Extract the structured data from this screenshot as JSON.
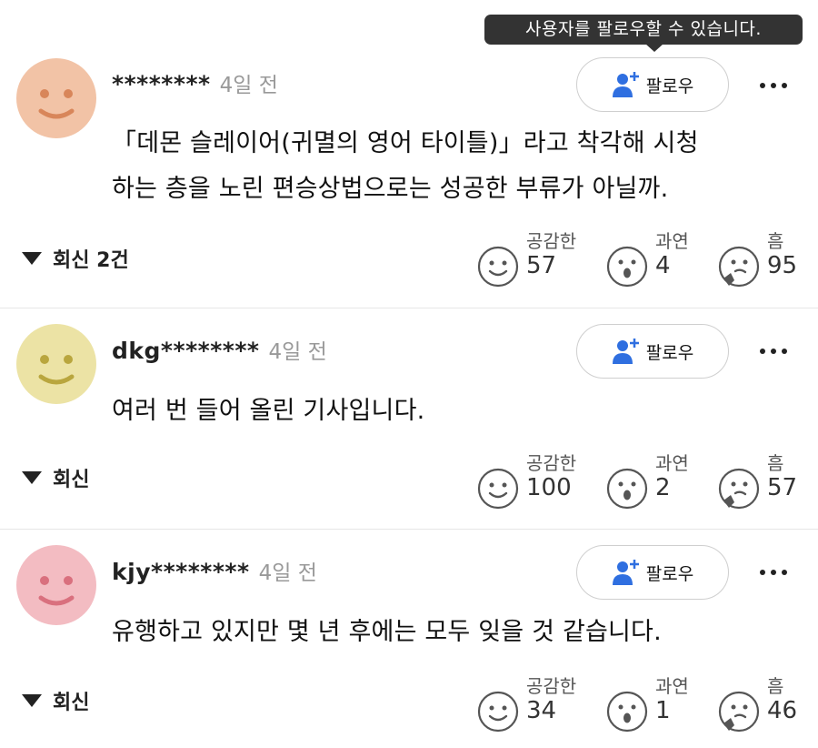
{
  "tooltip": {
    "text": "사용자를 팔로우할 수 있습니다."
  },
  "reactions_labels": {
    "like": "공감한",
    "wow": "과연",
    "hmm": "흠"
  },
  "comments": [
    {
      "username": "********",
      "time": "4일 전",
      "follow_label": "팔로우",
      "text_lines": [
        "「데몬 슬레이어(귀멸의 영어 타이틀)」라고 착각해 시청",
        "하는 층을 노린 편승상법으로는 성공한 부류가 아닐까."
      ],
      "reply_label": "회신 2건",
      "likes": "57",
      "wow": "4",
      "hmm": "95",
      "avatar_color": "#f2c3a6"
    },
    {
      "username": "dkg********",
      "time": "4일 전",
      "follow_label": "팔로우",
      "text_lines": [
        "여러 번 들어 올린 기사입니다."
      ],
      "reply_label": "회신",
      "likes": "100",
      "wow": "2",
      "hmm": "57",
      "avatar_color": "#ece3a5"
    },
    {
      "username": "kjy********",
      "time": "4일 전",
      "follow_label": "팔로우",
      "text_lines": [
        "유행하고 있지만 몇 년 후에는 모두 잊을 것 같습니다."
      ],
      "reply_label": "회신",
      "likes": "34",
      "wow": "1",
      "hmm": "46",
      "avatar_color": "#f3bcc2"
    }
  ],
  "colors": {
    "accent_blue": "#2f6fe0",
    "tooltip_bg": "#333333"
  }
}
